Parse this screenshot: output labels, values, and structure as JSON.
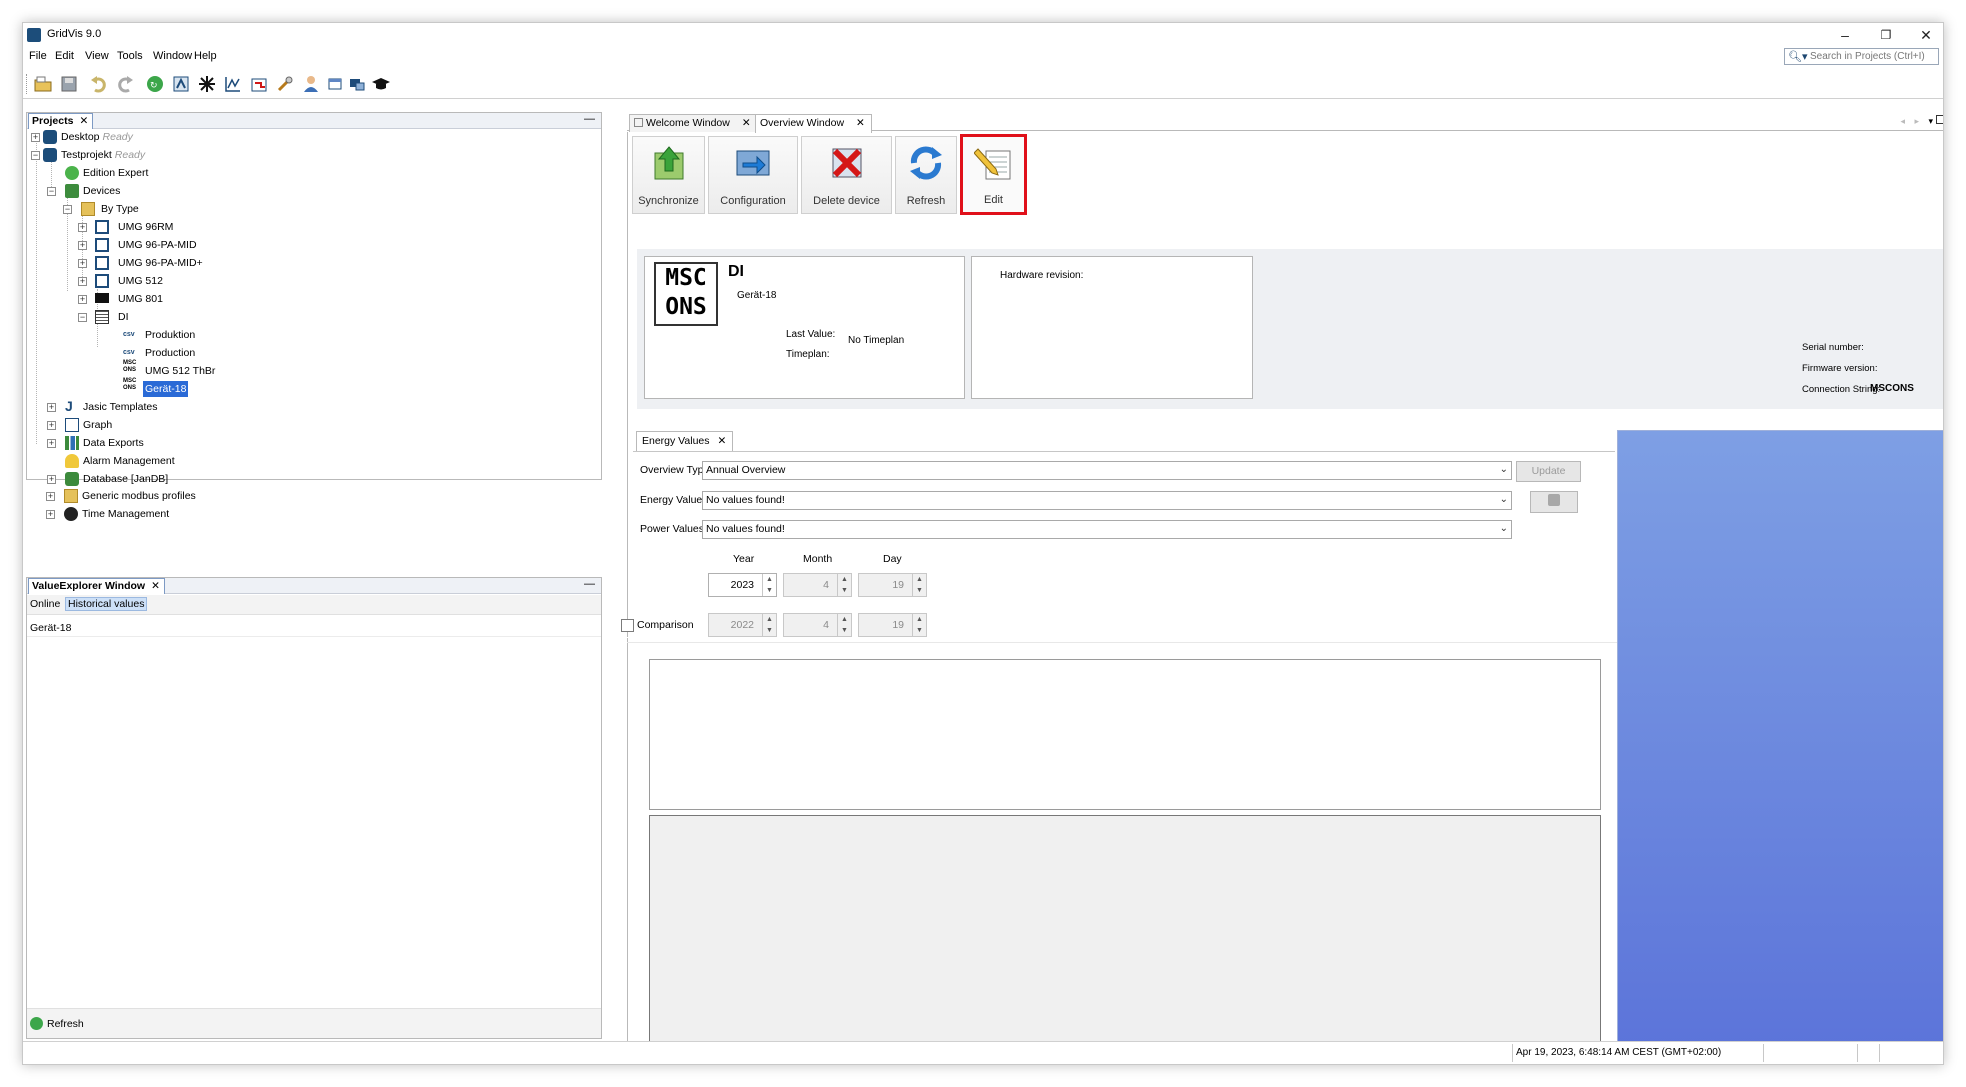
{
  "window": {
    "title": "GridVis 9.0",
    "controls": {
      "minimize": "–",
      "restore": "❐",
      "close": "✕"
    }
  },
  "menu": [
    "File",
    "Edit",
    "View",
    "Tools",
    "Window",
    "Help"
  ],
  "search": {
    "placeholder": "Search in Projects (Ctrl+I)"
  },
  "toolbar_icons": [
    "open-project-icon",
    "save-icon",
    "undo-icon",
    "redo-icon",
    "synchronize-icon",
    "device-config-icon",
    "asterisk-icon",
    "graph-icon",
    "import-icon",
    "tools-icon",
    "user-icon",
    "window-icon",
    "monitor-icon",
    "graduation-cap-icon"
  ],
  "projects_panel": {
    "tab": "Projects",
    "close": "✕",
    "minimize": "—",
    "tree": {
      "desktop": {
        "label": "Desktop",
        "status": "Ready"
      },
      "testprojekt": {
        "label": "Testprojekt",
        "status": "Ready"
      },
      "edition": "Edition Expert",
      "devices": "Devices",
      "by_type": "By Type",
      "device_types": [
        "UMG 96RM",
        "UMG 96-PA-MID",
        "UMG 96-PA-MID+",
        "UMG 512",
        "UMG 801"
      ],
      "di": "DI",
      "di_children": [
        "Produktion",
        "Production",
        "UMG  512 ThBr",
        "Gerät-18"
      ],
      "csv_tag": "csv",
      "mscons_tag": "MSC ONS",
      "root_items": [
        "Jasic Templates",
        "Graph",
        "Data Exports",
        "Alarm Management",
        "Database [JanDB]",
        "Generic modbus profiles",
        "Time Management"
      ]
    }
  },
  "value_explorer": {
    "tab": "ValueExplorer Window",
    "close": "✕",
    "minimize": "—",
    "modes": [
      "Online",
      "Historical values"
    ],
    "item": "Gerät-18",
    "refresh": "Refresh"
  },
  "editor": {
    "tabs": [
      {
        "label": "Welcome Window",
        "close": "✕"
      },
      {
        "label": "Overview Window",
        "close": "✕"
      }
    ],
    "buttons": [
      "Synchronize",
      "Configuration",
      "Delete device",
      "Refresh",
      "Edit"
    ],
    "device_card": {
      "logo_line1": "MSC",
      "logo_line2": "ONS",
      "name": "DI",
      "subtitle": "Gerät-18",
      "last_value_label": "Last Value:",
      "timeplan_label": "Timeplan:",
      "timeplan_value": "No Timeplan"
    },
    "hardware_label": "Hardware revision:",
    "serial_label": "Serial number:",
    "firmware_label": "Firmware version:",
    "connection_label": "Connection String:",
    "connection_value": "MSCONS",
    "energy_tab": {
      "label": "Energy Values",
      "close": "✕"
    },
    "overview_type_label": "Overview Type:",
    "overview_type_value": "Annual Overview",
    "energy_values_label": "Energy Values:",
    "energy_values_value": "No values found!",
    "power_values_label": "Power Values:",
    "power_values_value": "No values found!",
    "update_button": "Update",
    "col_year": "Year",
    "col_month": "Month",
    "col_day": "Day",
    "date": {
      "year": "2023",
      "month": "4",
      "day": "19"
    },
    "comparison_label": "Comparison",
    "comparison_date": {
      "year": "2022",
      "month": "4",
      "day": "19"
    }
  },
  "statusbar": {
    "timestamp": "Apr 19, 2023, 6:48:14 AM CEST (GMT+02:00)"
  },
  "colors": {
    "accent_blue": "#2a6ad6",
    "highlight_red": "#e0101a",
    "gradient_top": "#7e9fe4",
    "gradient_bottom": "#5b73d9"
  }
}
